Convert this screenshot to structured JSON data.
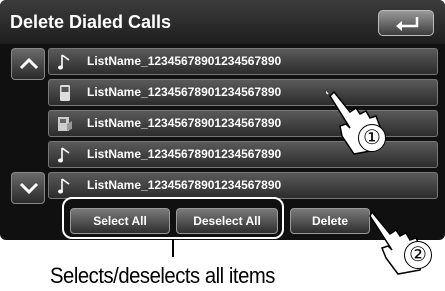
{
  "title": "Delete Dialed Calls",
  "back_icon": "back-arrow-icon",
  "up_icon": "chevron-up-icon",
  "down_icon": "chevron-down-icon",
  "rows": [
    {
      "label": "ListName_12345678901234567890",
      "icon": "music-note-icon"
    },
    {
      "label": "ListName_12345678901234567890",
      "icon": "phone-icon"
    },
    {
      "label": "ListName_12345678901234567890",
      "icon": "phone-book-icon"
    },
    {
      "label": "ListName_12345678901234567890",
      "icon": "music-note-icon"
    },
    {
      "label": "ListName_12345678901234567890",
      "icon": "music-note-icon"
    }
  ],
  "buttons": {
    "select_all": "Select All",
    "deselect_all": "Deselect All",
    "delete": "Delete"
  },
  "caption": "Selects/deselects all items",
  "callouts": [
    "①",
    "②"
  ]
}
